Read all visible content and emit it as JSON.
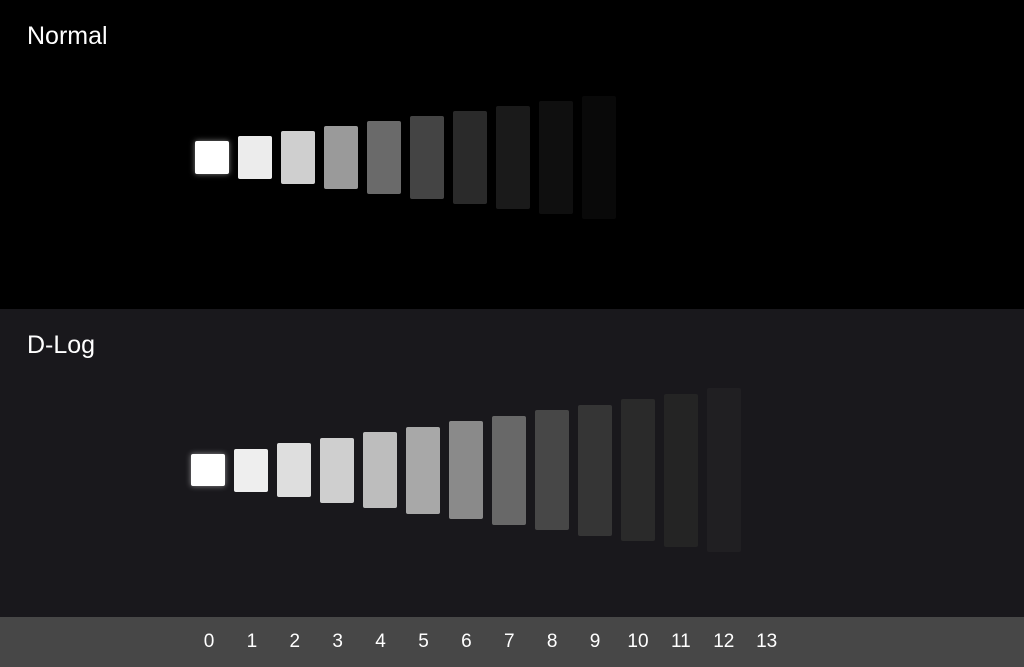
{
  "panels": {
    "normal": {
      "label": "Normal",
      "patch_colors": [
        "#ffffff",
        "#ececec",
        "#cfcfcf",
        "#9a9a9a",
        "#6a6a6a",
        "#444444",
        "#2a2a2a",
        "#1a1a1a",
        "#0f0f0f",
        "#090909"
      ]
    },
    "dlog": {
      "label": "D-Log",
      "patch_colors": [
        "#ffffff",
        "#eeeeee",
        "#dedede",
        "#cfcfcf",
        "#bdbdbd",
        "#a8a8a8",
        "#8a8a8a",
        "#686868",
        "#474747",
        "#353535",
        "#2a2a2a",
        "#242424",
        "#201f22"
      ]
    }
  },
  "scale": {
    "stops": [
      "0",
      "1",
      "2",
      "3",
      "4",
      "5",
      "6",
      "7",
      "8",
      "9",
      "10",
      "11",
      "12",
      "13"
    ]
  }
}
